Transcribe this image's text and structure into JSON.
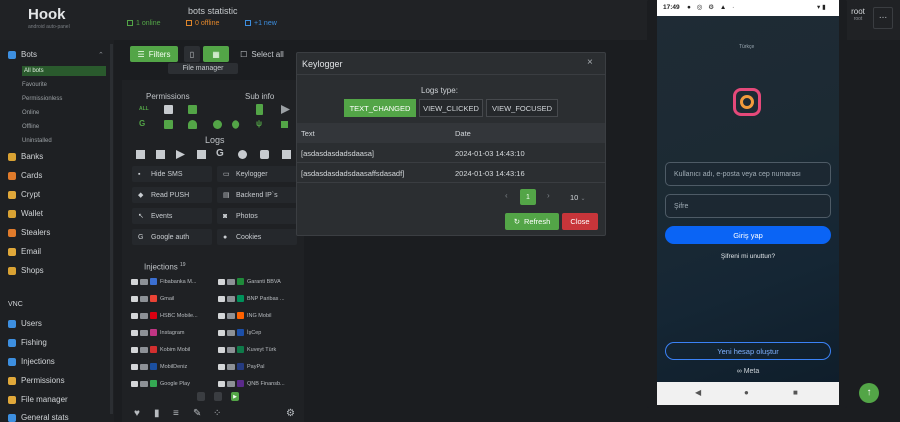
{
  "header": {
    "app_name": "Hook",
    "app_sub": "android auto-panel",
    "stats_title": "bots statistic",
    "online": "1 online",
    "offline": "0 offline",
    "new": "+1 new",
    "user_name": "root",
    "user_role": "root",
    "more": "..."
  },
  "colors": {
    "accent": "#53a547",
    "danger": "#c8353a",
    "offline": "#e0862b",
    "new": "#3d8fe0",
    "ig_blue": "#0a64f5"
  },
  "sidebar": {
    "bots": "Bots",
    "sub": [
      "All bots",
      "Favourite",
      "Permissionless",
      "Online",
      "Offline",
      "Uninstalled"
    ],
    "items": [
      "Banks",
      "Cards",
      "Crypt",
      "Wallet",
      "Stealers",
      "Email",
      "Shops"
    ],
    "vnc": "VNC",
    "items2": [
      "Users",
      "Fishing",
      "Injections",
      "Permissions",
      "File manager",
      "General stats"
    ]
  },
  "toolbar": {
    "filters": "Filters",
    "select_all": "Select all",
    "file_manager": "File manager"
  },
  "panel": {
    "permissions": "Permissions",
    "sub_info": "Sub info",
    "all": "ALL",
    "logs": "Logs",
    "features": [
      "Hide SMS",
      "Keylogger",
      "Read PUSH",
      "Backend IP`s",
      "Events",
      "Photos",
      "Google auth",
      "Cookies"
    ],
    "injections_title": "Injections",
    "injections_count": "19",
    "injections_left": [
      "Fibabanka M...",
      "Gmail",
      "HSBC Mobile...",
      "Instagram",
      "Kobim Mobil",
      "MobilDeniz",
      "Google Play"
    ],
    "injections_right": [
      "Garanti BBVA",
      "BNP Paribas ...",
      "ING Mobil",
      "İşCep",
      "Kuveyt Türk",
      "PayPal",
      "QNB Finansb..."
    ]
  },
  "modal": {
    "title": "Keylogger",
    "close_icon": "×",
    "logs_type_label": "Logs type:",
    "types": [
      "TEXT_CHANGED",
      "VIEW_CLICKED",
      "VIEW_FOCUSED"
    ],
    "columns": [
      "Text",
      "Date"
    ],
    "rows": [
      {
        "text": "[asdasdasdadsdaasa]",
        "date": "2024-01-03 14:43:10"
      },
      {
        "text": "[asdasdasdadsdaasaffsdasadf]",
        "date": "2024-01-03 14:43:16"
      }
    ],
    "page": "1",
    "page_size": "10",
    "refresh": "Refresh",
    "close": "Close"
  },
  "phone": {
    "time": "17:49",
    "language": "Türkçe",
    "username_placeholder": "Kullanıcı adı, e-posta veya cep numarası",
    "password_placeholder": "Şifre",
    "login": "Giriş yap",
    "forgot": "Şifreni mi unuttun?",
    "new_account": "Yeni hesap oluştur",
    "meta": "Meta"
  }
}
